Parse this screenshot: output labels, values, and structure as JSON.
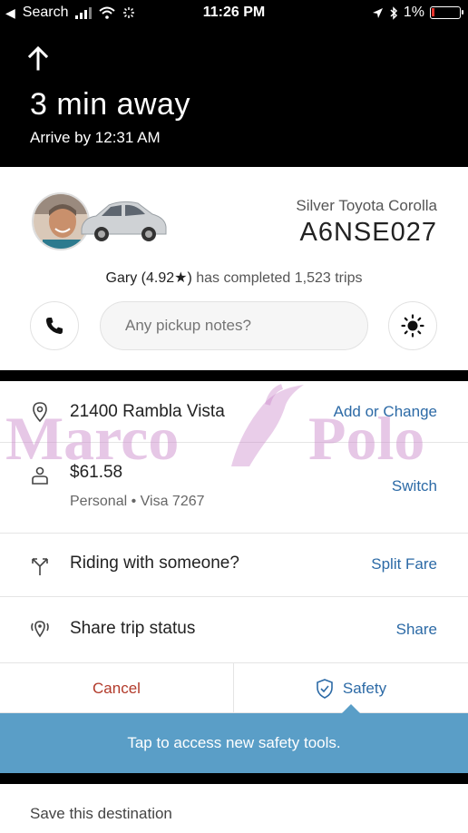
{
  "status_bar": {
    "back_label": "Search",
    "time": "11:26 PM",
    "battery": "1%",
    "icons": [
      "signal-icon",
      "wifi-icon",
      "activity-icon",
      "location-arrow-icon",
      "bluetooth-icon",
      "battery-icon"
    ]
  },
  "trip": {
    "eta": "3 min away",
    "arrive": "Arrive by 12:31 AM"
  },
  "driver": {
    "car_model": "Silver Toyota Corolla",
    "plate": "A6NSE027",
    "name_rating": "Gary (4.92★)",
    "trips_text": " has completed 1,523 trips",
    "notes_placeholder": "Any pickup notes?"
  },
  "rows": {
    "destination": {
      "title": "21400 Rambla Vista",
      "action": "Add or Change"
    },
    "payment": {
      "title": "$61.58",
      "sub": "Personal • Visa 7267",
      "action": "Switch"
    },
    "split": {
      "title": "Riding with someone?",
      "action": "Split Fare"
    },
    "share": {
      "title": "Share trip status",
      "action": "Share"
    }
  },
  "actions": {
    "cancel": "Cancel",
    "safety": "Safety"
  },
  "banner": "Tap to access new safety tools.",
  "footer": {
    "save": "Save this destination"
  },
  "watermark": {
    "left": "Marco",
    "right": "Polo"
  },
  "colors": {
    "link": "#2c6aa6",
    "cancel": "#b23a2a",
    "banner": "#5a9ec7",
    "battery_low": "#e5342c"
  }
}
